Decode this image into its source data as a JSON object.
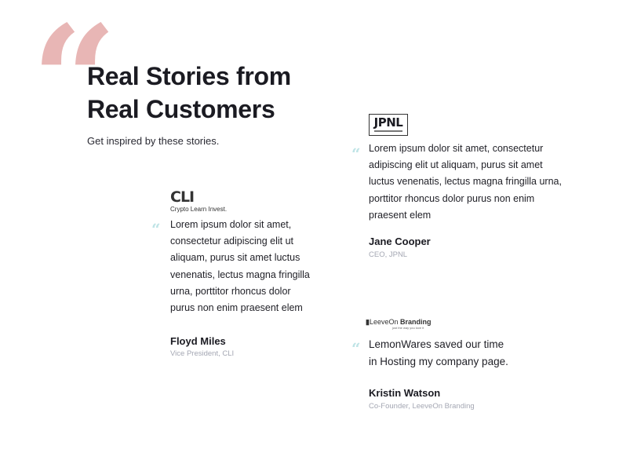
{
  "hero": {
    "quote_glyph": "“",
    "title_line1": "Real Stories from",
    "title_line2": "Real Customers",
    "subtitle": "Get inspired by these stories."
  },
  "colors": {
    "big_quote": "#e8b6b5",
    "small_quote": "#bfe4e6",
    "role": "#a4a7b3"
  },
  "testimonials": [
    {
      "logo_text": "CLI",
      "logo_tagline": "Crypto Learn Invest.",
      "lines": [
        "Lorem ipsum dolor sit amet,",
        "consectetur adipiscing elit ut",
        "aliquam, purus sit amet luctus",
        "venenatis, lectus magna fringilla",
        "urna, porttitor rhoncus dolor",
        "purus non enim praesent elem"
      ],
      "name": "Floyd Miles",
      "role": "Vice President, CLI"
    },
    {
      "logo_text": "JPNL",
      "lines": [
        "Lorem ipsum dolor sit amet, consectetur",
        "adipiscing elit ut aliquam, purus sit amet",
        "luctus venenatis, lectus magna fringilla urna,",
        "porttitor rhoncus dolor purus non enim",
        "praesent elem"
      ],
      "name": "Jane Cooper",
      "role": "CEO, JPNL"
    },
    {
      "logo_text": "LeeveOn",
      "logo_text_bold": "Branding",
      "logo_tagline": "just the way you love it",
      "lines": [
        "LemonWares saved our time",
        "in Hosting my company page."
      ],
      "name": "Kristin Watson",
      "role": "Co-Founder, LeeveOn Branding"
    }
  ]
}
